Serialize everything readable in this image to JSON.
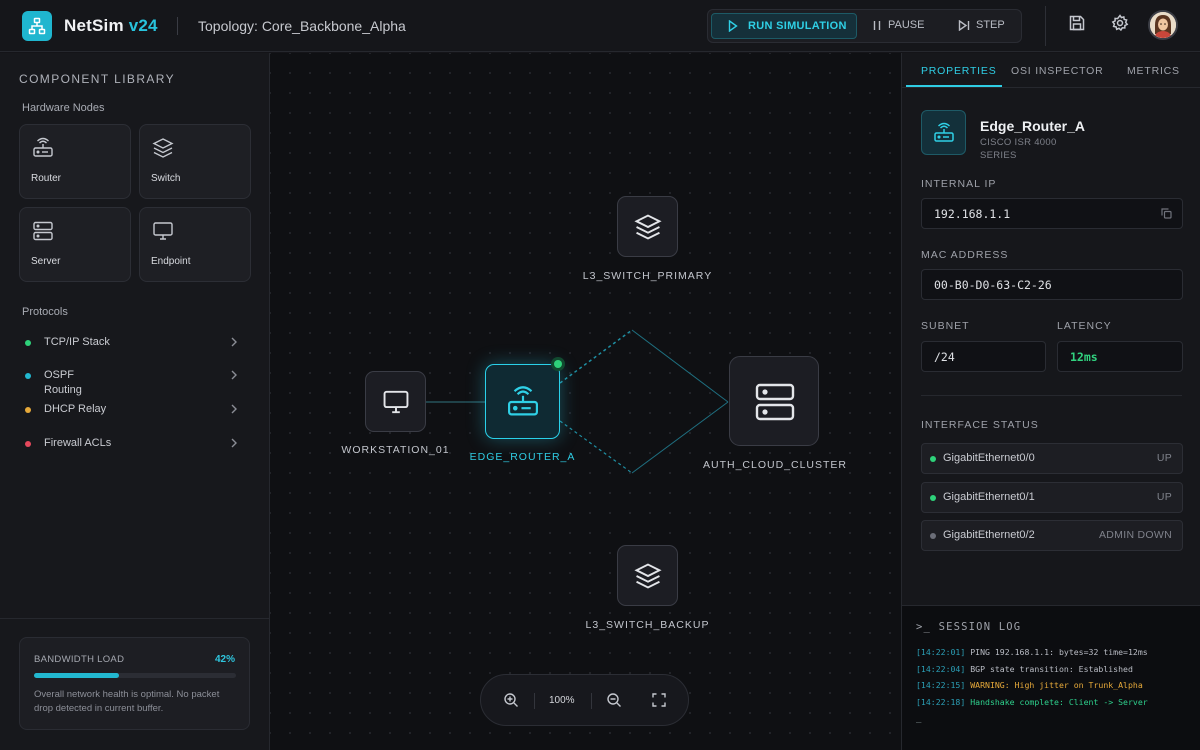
{
  "header": {
    "brand": "NetSim",
    "version": "v24",
    "topology": "Topology: Core_Backbone_Alpha",
    "run_label": "RUN SIMULATION",
    "pause_label": "PAUSE",
    "step_label": "STEP",
    "icons": [
      "save-icon",
      "settings-gear-icon",
      "user-avatar"
    ]
  },
  "sidebar": {
    "title": "COMPONENT LIBRARY",
    "hardware_heading": "Hardware Nodes",
    "hardware": [
      {
        "label": "Router",
        "icon": "router-icon"
      },
      {
        "label": "Switch",
        "icon": "layers-icon"
      },
      {
        "label": "Server",
        "icon": "server-icon"
      },
      {
        "label": "Endpoint",
        "icon": "monitor-icon"
      }
    ],
    "protocols_heading": "Protocols",
    "protocols": [
      {
        "name": "TCP/IP Stack",
        "color": "#2ed27a"
      },
      {
        "name": "OSPF Routing",
        "color": "#22b8d0"
      },
      {
        "name": "DHCP Relay",
        "color": "#e6a93a"
      },
      {
        "name": "Firewall ACLs",
        "color": "#e5485c"
      }
    ],
    "bandwidth": {
      "title": "BANDWIDTH LOAD",
      "percent_label": "42%",
      "percent": 42,
      "description": "Overall network health is optimal. No packet drop detected in current buffer."
    }
  },
  "canvas": {
    "nodes": {
      "switch_primary": "L3_SWITCH_PRIMARY",
      "workstation": "WORKSTATION_01",
      "edge_router": "EDGE_ROUTER_A",
      "cloud_cluster": "AUTH_CLOUD_CLUSTER",
      "switch_backup": "L3_SWITCH_BACKUP"
    },
    "zoom": "100%"
  },
  "panel": {
    "tabs": [
      "PROPERTIES",
      "OSI INSPECTOR",
      "METRICS"
    ],
    "active_tab": "PROPERTIES",
    "device": {
      "name": "Edge_Router_A",
      "model": "CISCO ISR 4000 SERIES"
    },
    "fields": {
      "internal_ip_label": "INTERNAL IP",
      "internal_ip": "192.168.1.1",
      "mac_label": "MAC ADDRESS",
      "mac": "00-B0-D0-63-C2-26",
      "subnet_label": "SUBNET",
      "subnet": "/24",
      "latency_label": "LATENCY",
      "latency": "12ms"
    },
    "interface_heading": "INTERFACE STATUS",
    "interfaces": [
      {
        "name": "GigabitEthernet0/0",
        "status": "UP",
        "color": "#2ed27a"
      },
      {
        "name": "GigabitEthernet0/1",
        "status": "UP",
        "color": "#2ed27a"
      },
      {
        "name": "GigabitEthernet0/2",
        "status": "ADMIN DOWN",
        "color": "#6b6e78"
      }
    ]
  },
  "log": {
    "title": ">_  SESSION LOG",
    "lines": [
      {
        "ts": "[14:22:01]",
        "msg": "PING 192.168.1.1: bytes=32 time=12ms",
        "kind": "info"
      },
      {
        "ts": "[14:22:04]",
        "msg": "BGP state transition: Established",
        "kind": "info"
      },
      {
        "ts": "[14:22:15]",
        "msg": "WARNING: High jitter on Trunk_Alpha",
        "kind": "warn"
      },
      {
        "ts": "[14:22:18]",
        "msg": "Handshake complete: Client -> Server",
        "kind": "ok"
      }
    ],
    "cursor": "_"
  },
  "colors": {
    "accent": "#22b8d0",
    "success": "#2ed27a",
    "warning": "#e6a93a",
    "danger": "#e5485c"
  }
}
